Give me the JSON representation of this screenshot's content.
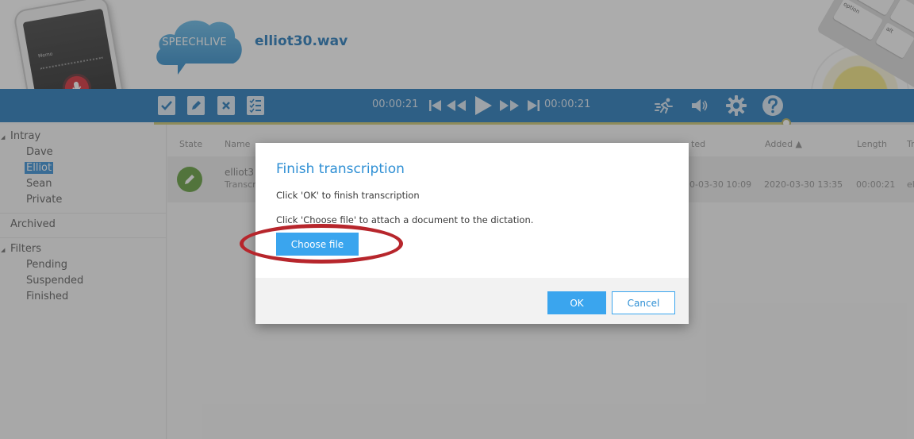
{
  "app": {
    "logo_text": "SPEECHLIVE",
    "file_name": "elliot30.wav"
  },
  "toolbar": {
    "time_elapsed": "00:00:21",
    "time_total": "00:00:21",
    "playback_progress": 1.0,
    "icons": [
      "checkbox-icon",
      "edit-icon",
      "delete-icon",
      "checklist-icon",
      "skip-back-icon",
      "rewind-icon",
      "play-icon",
      "fast-forward-icon",
      "skip-forward-icon",
      "running-man-icon",
      "volume-icon",
      "gear-icon",
      "help-icon"
    ]
  },
  "sidebar": {
    "intray_label": "Intray",
    "users": [
      "Dave",
      "Elliot",
      "Sean",
      "Private"
    ],
    "selected_user": "Elliot",
    "archived_label": "Archived",
    "filters_label": "Filters",
    "filters": [
      "Pending",
      "Suspended",
      "Finished"
    ]
  },
  "list": {
    "columns": [
      "State",
      "Name",
      "ted",
      "Added ▲",
      "Length",
      "Tr"
    ],
    "row": {
      "name": "elliot3",
      "subtitle": "Transcr",
      "created": "0-03-30 10:09",
      "added": "2020-03-30 13:35",
      "length": "00:00:21",
      "transcriber": "el"
    }
  },
  "dialog": {
    "title": "Finish transcription",
    "line1": "Click 'OK' to finish transcription",
    "line2": "Click 'Choose file' to attach a document to the dictation.",
    "choose_label": "Choose file",
    "ok_label": "OK",
    "cancel_label": "Cancel"
  },
  "colors": {
    "brand_blue": "#1a73b8",
    "button_blue": "#3aa5ee",
    "highlight_red": "#b7262c",
    "state_green": "#5c9a34"
  }
}
